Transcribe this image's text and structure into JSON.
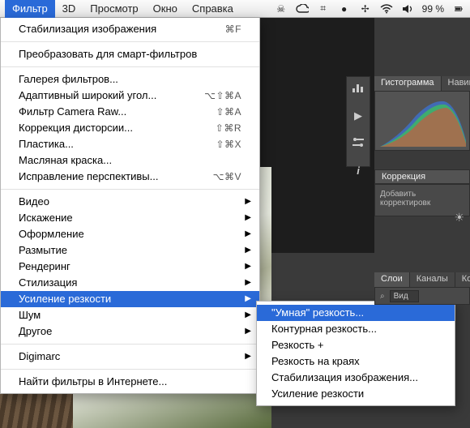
{
  "menubar": {
    "items": [
      "Фильтр",
      "3D",
      "Просмотр",
      "Окно",
      "Справка"
    ],
    "battery": "99 %",
    "status_icons": [
      "skull",
      "cc",
      "slack",
      "oval",
      "spark",
      "wifi",
      "vol"
    ]
  },
  "filter_menu": {
    "g1": [
      {
        "label": "Стабилизация изображения",
        "shortcut": "⌘F",
        "sub": false
      }
    ],
    "g2": [
      {
        "label": "Преобразовать для смарт-фильтров",
        "shortcut": "",
        "sub": false
      }
    ],
    "g3": [
      {
        "label": "Галерея фильтров...",
        "shortcut": "",
        "sub": false
      },
      {
        "label": "Адаптивный широкий угол...",
        "shortcut": "⌥⇧⌘A",
        "sub": false
      },
      {
        "label": "Фильтр Camera Raw...",
        "shortcut": "⇧⌘A",
        "sub": false
      },
      {
        "label": "Коррекция дисторсии...",
        "shortcut": "⇧⌘R",
        "sub": false
      },
      {
        "label": "Пластика...",
        "shortcut": "⇧⌘X",
        "sub": false
      },
      {
        "label": "Масляная краска...",
        "shortcut": "",
        "sub": false
      },
      {
        "label": "Исправление перспективы...",
        "shortcut": "⌥⌘V",
        "sub": false
      }
    ],
    "g4": [
      {
        "label": "Видео",
        "shortcut": "",
        "sub": true
      },
      {
        "label": "Искажение",
        "shortcut": "",
        "sub": true
      },
      {
        "label": "Оформление",
        "shortcut": "",
        "sub": true
      },
      {
        "label": "Размытие",
        "shortcut": "",
        "sub": true
      },
      {
        "label": "Рендеринг",
        "shortcut": "",
        "sub": true
      },
      {
        "label": "Стилизация",
        "shortcut": "",
        "sub": true
      },
      {
        "label": "Усиление резкости",
        "shortcut": "",
        "sub": true,
        "highlight": true
      },
      {
        "label": "Шум",
        "shortcut": "",
        "sub": true
      },
      {
        "label": "Другое",
        "shortcut": "",
        "sub": true
      }
    ],
    "g5": [
      {
        "label": "Digimarc",
        "shortcut": "",
        "sub": true
      }
    ],
    "g6": [
      {
        "label": "Найти фильтры в Интернете...",
        "shortcut": "",
        "sub": false
      }
    ]
  },
  "sharpen_submenu": {
    "items": [
      {
        "label": "\"Умная\" резкость...",
        "highlight": true
      },
      {
        "label": "Контурная резкость..."
      },
      {
        "label": "Резкость +"
      },
      {
        "label": "Резкость на краях"
      },
      {
        "label": "Стабилизация изображения..."
      },
      {
        "label": "Усиление резкости"
      }
    ]
  },
  "panels": {
    "hist_tabs": [
      "Гистограмма",
      "Навигат"
    ],
    "correction_tab": "Коррекция",
    "correction_hint": "Добавить корректировк",
    "layers_tabs": [
      "Слои",
      "Каналы",
      "Контур"
    ],
    "layers_search_label": "Вид",
    "search_icon": "⌕"
  }
}
